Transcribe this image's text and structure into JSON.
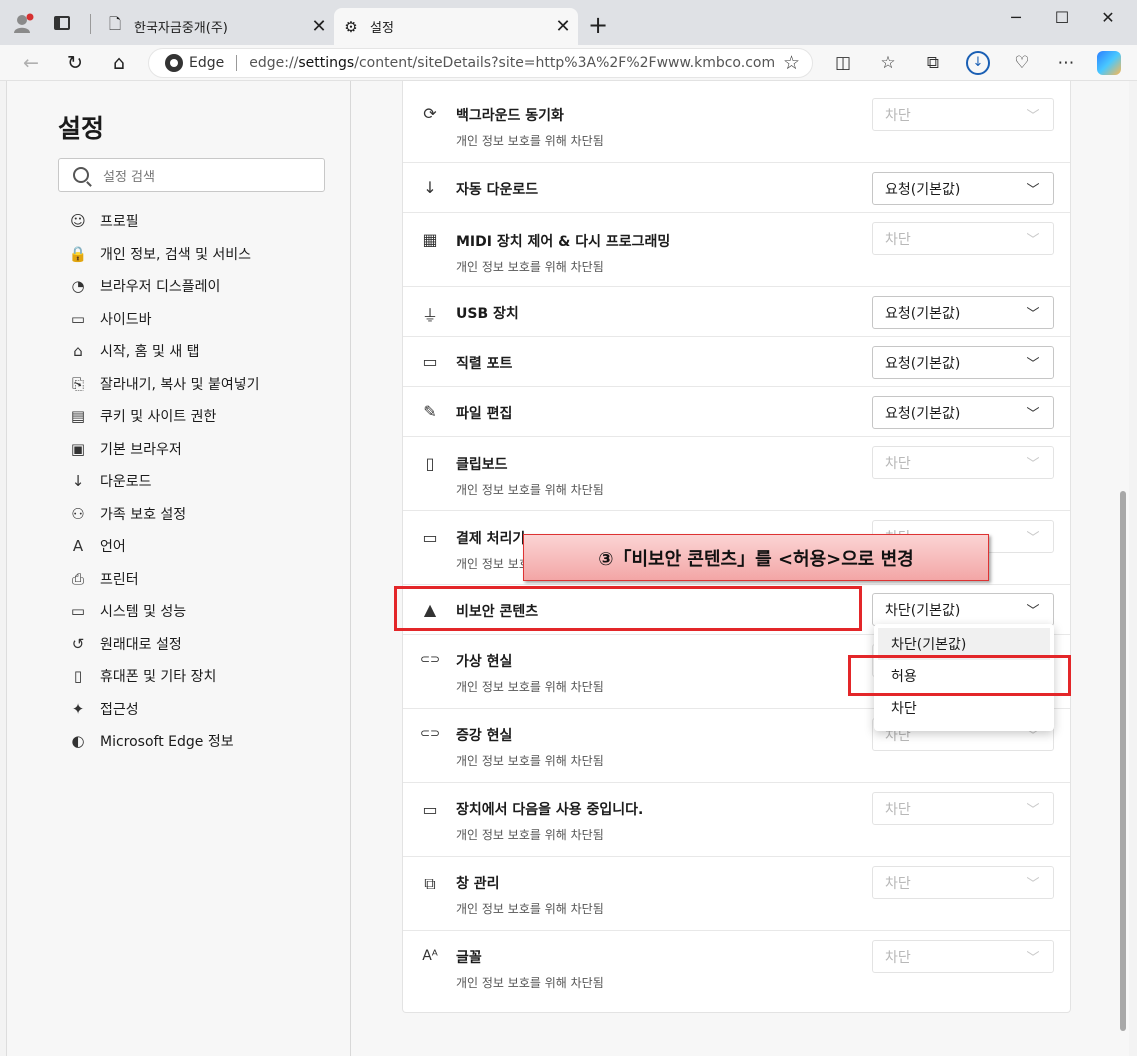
{
  "tabs": [
    {
      "label": "한국자금중개(주)",
      "close": "✕"
    },
    {
      "label": "설정",
      "close": "✕"
    }
  ],
  "window_controls": {
    "min": "─",
    "max": "☐",
    "close": "✕"
  },
  "address": {
    "site_label": "Edge",
    "url_prefix": "edge://",
    "url_host": "settings",
    "url_rest": "/content/siteDetails?site=http%3A%2F%2Fwww.kmbco.com"
  },
  "sidebar": {
    "title": "설정",
    "search_placeholder": "설정 검색",
    "items": [
      {
        "label": "프로필",
        "icon": "☺"
      },
      {
        "label": "개인 정보, 검색 및 서비스",
        "icon": "🔒"
      },
      {
        "label": "브라우저 디스플레이",
        "icon": "◔"
      },
      {
        "label": "사이드바",
        "icon": "▭"
      },
      {
        "label": "시작, 홈 및 새 탭",
        "icon": "⌂"
      },
      {
        "label": "잘라내기, 복사 및 붙여넣기",
        "icon": "⎘"
      },
      {
        "label": "쿠키 및 사이트 권한",
        "icon": "▤"
      },
      {
        "label": "기본 브라우저",
        "icon": "▣"
      },
      {
        "label": "다운로드",
        "icon": "↓"
      },
      {
        "label": "가족 보호 설정",
        "icon": "⚇"
      },
      {
        "label": "언어",
        "icon": "A"
      },
      {
        "label": "프린터",
        "icon": "⎙"
      },
      {
        "label": "시스템 및 성능",
        "icon": "▭"
      },
      {
        "label": "원래대로 설정",
        "icon": "↺"
      },
      {
        "label": "휴대폰 및 기타 장치",
        "icon": "▯"
      },
      {
        "label": "접근성",
        "icon": "✦"
      },
      {
        "label": "Microsoft Edge 정보",
        "icon": "◐"
      }
    ]
  },
  "permissions": [
    {
      "title": "백그라운드 동기화",
      "subtitle": "개인 정보 보호를 위해 차단됨",
      "value": "차단",
      "icon": "⟳"
    },
    {
      "title": "자동 다운로드",
      "subtitle": "",
      "value": "요청(기본값)",
      "icon": "↓"
    },
    {
      "title": "MIDI 장치 제어 & 다시 프로그래밍",
      "subtitle": "개인 정보 보호를 위해 차단됨",
      "value": "차단",
      "icon": "▦"
    },
    {
      "title": "USB 장치",
      "subtitle": "",
      "value": "요청(기본값)",
      "icon": "⏚"
    },
    {
      "title": "직렬 포트",
      "subtitle": "",
      "value": "요청(기본값)",
      "icon": "▭"
    },
    {
      "title": "파일 편집",
      "subtitle": "",
      "value": "요청(기본값)",
      "icon": "✎"
    },
    {
      "title": "클립보드",
      "subtitle": "개인 정보 보호를 위해 차단됨",
      "value": "차단",
      "icon": "▯"
    },
    {
      "title": "결제 처리기",
      "subtitle": "개인 정보 보호를 위해 차단됨",
      "value": "차단",
      "icon": "▭"
    },
    {
      "title": "비보안 콘텐츠",
      "subtitle": "",
      "value": "차단(기본값)",
      "icon": "▲"
    },
    {
      "title": "가상 현실",
      "subtitle": "개인 정보 보호를 위해 차단됨",
      "value": "차단",
      "icon": "⊂⊃"
    },
    {
      "title": "증강 현실",
      "subtitle": "개인 정보 보호를 위해 차단됨",
      "value": "차단",
      "icon": "⊂⊃"
    },
    {
      "title": "장치에서 다음을 사용 중입니다.",
      "subtitle": "개인 정보 보호를 위해 차단됨",
      "value": "차단",
      "icon": "▭"
    },
    {
      "title": "창 관리",
      "subtitle": "개인 정보 보호를 위해 차단됨",
      "value": "차단",
      "icon": "⧉"
    },
    {
      "title": "글꼴",
      "subtitle": "개인 정보 보호를 위해 차단됨",
      "value": "차단",
      "icon": "Aᴬ"
    }
  ],
  "dropdown_options": [
    "차단(기본값)",
    "허용",
    "차단"
  ],
  "callout_text": "③「비보안 콘텐츠」를 <허용>으로 변경",
  "colors": {
    "annotation_red": "#e32629",
    "callout_fill": "#f3a6a6",
    "download_blue": "#1a5fb4"
  }
}
